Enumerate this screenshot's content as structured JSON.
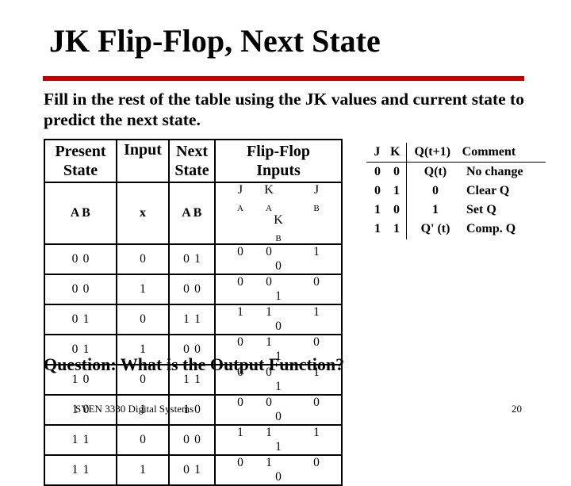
{
  "slide": {
    "title": "JK Flip-Flop, Next State",
    "accent_color": "#c00000",
    "instruction": "Fill in the rest of the table using the JK values and current state to predict the next state.",
    "question": "Question:  What is the Output Function?",
    "footer_course": "SYEN 3330 Digital Systems",
    "page_number": "20"
  },
  "state_table": {
    "headers": {
      "present_state_1": "Present",
      "present_state_2": "State",
      "input": "Input",
      "next_state_1": "Next",
      "next_state_2": "State",
      "ff_inputs_1": "Flip-Flop",
      "ff_inputs_2": "Inputs"
    },
    "subheaders": {
      "present": [
        "A",
        "B"
      ],
      "input": "x",
      "next": [
        "A",
        "B"
      ],
      "ff": [
        {
          "base": "J",
          "sub": "A"
        },
        {
          "base": "K",
          "sub": "A"
        },
        {
          "base": "J",
          "sub": "B"
        },
        {
          "base": "K",
          "sub": "B"
        }
      ]
    },
    "rows": [
      {
        "present": [
          "0",
          "0"
        ],
        "x": "0",
        "next": [
          "0",
          "1"
        ],
        "ff": [
          "0",
          "0",
          "1",
          "0"
        ]
      },
      {
        "present": [
          "0",
          "0"
        ],
        "x": "1",
        "next": [
          "0",
          "0"
        ],
        "ff": [
          "0",
          "0",
          "0",
          "1"
        ]
      },
      {
        "present": [
          "0",
          "1"
        ],
        "x": "0",
        "next": [
          "1",
          "1"
        ],
        "ff": [
          "1",
          "1",
          "1",
          "0"
        ]
      },
      {
        "present": [
          "0",
          "1"
        ],
        "x": "1",
        "next": [
          "0",
          "0"
        ],
        "ff": [
          "0",
          "1",
          "0",
          "1"
        ]
      },
      {
        "present": [
          "1",
          "0"
        ],
        "x": "0",
        "next": [
          "1",
          "1"
        ],
        "ff": [
          "0",
          "0",
          "1",
          "1"
        ]
      },
      {
        "present": [
          "1",
          "0"
        ],
        "x": "1",
        "next": [
          "1",
          "0"
        ],
        "ff": [
          "0",
          "0",
          "0",
          "0"
        ]
      },
      {
        "present": [
          "1",
          "1"
        ],
        "x": "0",
        "next": [
          "0",
          "0"
        ],
        "ff": [
          "1",
          "1",
          "1",
          "1"
        ]
      },
      {
        "present": [
          "1",
          "1"
        ],
        "x": "1",
        "next": [
          "0",
          "1"
        ],
        "ff": [
          "0",
          "1",
          "0",
          "0"
        ]
      }
    ]
  },
  "jk_table": {
    "headers": [
      "J",
      "K",
      "Q(t+1)",
      "Comment"
    ],
    "rows": [
      [
        "0",
        "0",
        "Q(t)",
        "No change"
      ],
      [
        "0",
        "1",
        "0",
        "Clear Q"
      ],
      [
        "1",
        "0",
        "1",
        "Set Q"
      ],
      [
        "1",
        "1",
        "Q' (t)",
        "Comp. Q"
      ]
    ]
  }
}
